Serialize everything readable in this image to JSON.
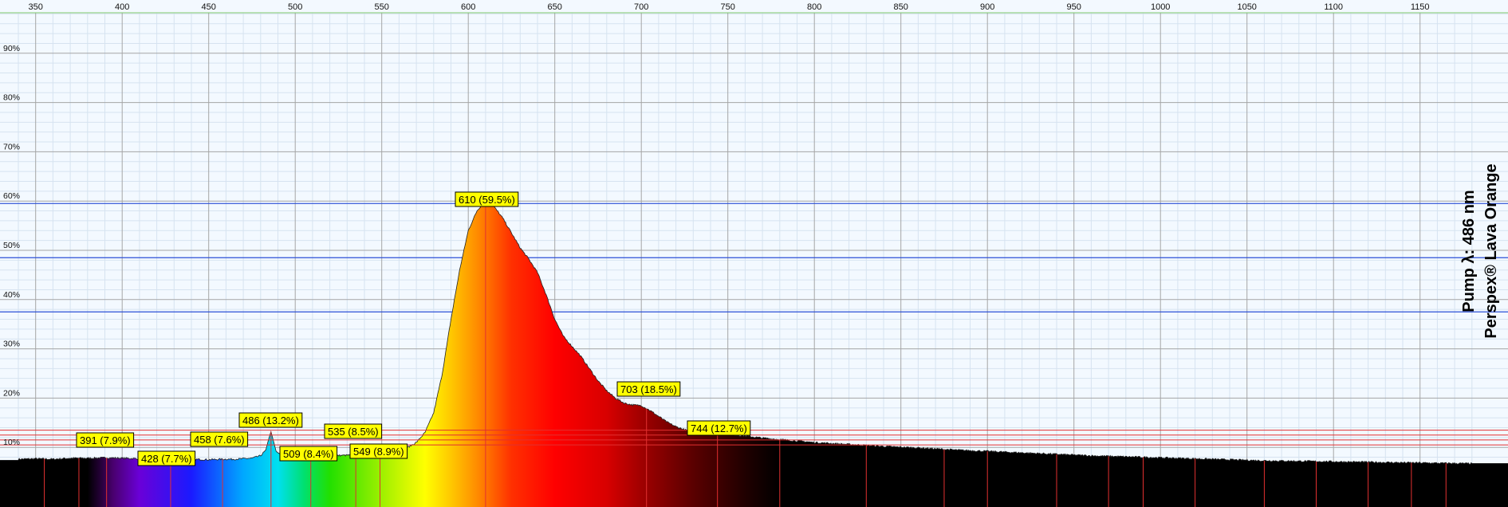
{
  "chart_data": {
    "type": "area",
    "xlim": [
      340,
      1180
    ],
    "ylim": [
      0,
      100
    ],
    "x_ticks": [
      350,
      400,
      450,
      500,
      550,
      600,
      650,
      700,
      750,
      800,
      850,
      900,
      950,
      1000,
      1050,
      1100,
      1150
    ],
    "x_tick_labels": [
      "350",
      "400",
      "450",
      "500",
      "550",
      "600",
      "650",
      "700",
      "750",
      "800",
      "850",
      "900",
      "950",
      "1000",
      "1050",
      "1100",
      "1150"
    ],
    "y_ticks": [
      10,
      20,
      30,
      40,
      50,
      60,
      70,
      80,
      90
    ],
    "y_tick_labels": [
      "10%",
      "20%",
      "30%",
      "40%",
      "50%",
      "60%",
      "70%",
      "80%",
      "90%"
    ],
    "grid": true,
    "fill": "wavelength-spectrum gradient",
    "series": [
      {
        "x": [
          340,
          350,
          360,
          370,
          380,
          391,
          400,
          410,
          420,
          428,
          440,
          450,
          458,
          465,
          470,
          475,
          480,
          483,
          484.5,
          486,
          487.5,
          489,
          492,
          495,
          500,
          509,
          520,
          530,
          535,
          540,
          549,
          555,
          560,
          565,
          570,
          575,
          580,
          585,
          590,
          595,
          600,
          605,
          608,
          610,
          612,
          615,
          620,
          625,
          630,
          635,
          640,
          645,
          650,
          655,
          660,
          665,
          670,
          675,
          680,
          685,
          690,
          695,
          700,
          705,
          710,
          715,
          720,
          725,
          730,
          735,
          740,
          744,
          750,
          760,
          770,
          780,
          790,
          800,
          820,
          840,
          860,
          880,
          900,
          920,
          940,
          960,
          980,
          1000,
          1020,
          1040,
          1060,
          1080,
          1100,
          1120,
          1140,
          1160,
          1180
        ],
        "y": [
          7.6,
          7.7,
          7.6,
          7.8,
          7.8,
          7.9,
          7.8,
          7.7,
          7.6,
          7.7,
          7.6,
          7.5,
          7.6,
          7.6,
          7.7,
          7.8,
          8.3,
          9.5,
          11.5,
          13.2,
          11.2,
          9.2,
          8.3,
          8.2,
          8.2,
          8.4,
          8.3,
          8.4,
          8.5,
          8.6,
          8.9,
          9.1,
          9.4,
          10.0,
          11.0,
          13.0,
          17.0,
          25.0,
          36.0,
          46.0,
          54.0,
          58.0,
          59.3,
          59.5,
          59.4,
          58.8,
          56.5,
          53.5,
          50.5,
          48.2,
          45.5,
          41.0,
          36.0,
          32.5,
          30.5,
          28.5,
          26.0,
          23.5,
          21.5,
          20.0,
          19.0,
          18.6,
          18.5,
          17.5,
          16.3,
          15.1,
          14.2,
          13.6,
          13.1,
          12.8,
          12.7,
          12.7,
          12.6,
          12.3,
          11.9,
          11.6,
          11.3,
          11.0,
          10.6,
          10.2,
          9.9,
          9.5,
          9.2,
          8.9,
          8.6,
          8.3,
          8.1,
          7.9,
          7.7,
          7.5,
          7.3,
          7.2,
          7.1,
          7.0,
          6.9,
          6.8,
          6.7
        ]
      }
    ],
    "peaks": [
      {
        "x": 391,
        "label": "391 (7.9%)"
      },
      {
        "x": 428,
        "label": "428 (7.7%)"
      },
      {
        "x": 458,
        "label": "458 (7.6%)"
      },
      {
        "x": 486,
        "label": "486 (13.2%)"
      },
      {
        "x": 509,
        "label": "509 (8.4%)"
      },
      {
        "x": 535,
        "label": "535 (8.5%)"
      },
      {
        "x": 549,
        "label": "549 (8.9%)"
      },
      {
        "x": 610,
        "label": "610 (59.5%)"
      },
      {
        "x": 703,
        "label": "703 (18.5%)"
      },
      {
        "x": 744,
        "label": "744 (12.7%)"
      }
    ],
    "blue_reference_lines": [
      59.5,
      48.5,
      37.5
    ],
    "red_reference_lines": [
      13.5,
      12.5,
      11.5,
      10.5
    ],
    "red_marker_lines": [
      355,
      375,
      391,
      428,
      458,
      486,
      509,
      535,
      549,
      610,
      703,
      744,
      780,
      830,
      875,
      900,
      940,
      970,
      990,
      1020,
      1060,
      1090,
      1120,
      1145,
      1165
    ],
    "side_labels": [
      "Pump λ: 486 nm",
      "Perspex® Lava Orange"
    ]
  },
  "colors": {
    "background": "#f3f9ff",
    "grid_major": "#a5a5a5",
    "grid_minor": "#d6e3f0",
    "top_line": "#7ec96b",
    "blue_line": "#2b4fd6",
    "red_line": "#e23030",
    "label_bg": "#ffff00"
  }
}
